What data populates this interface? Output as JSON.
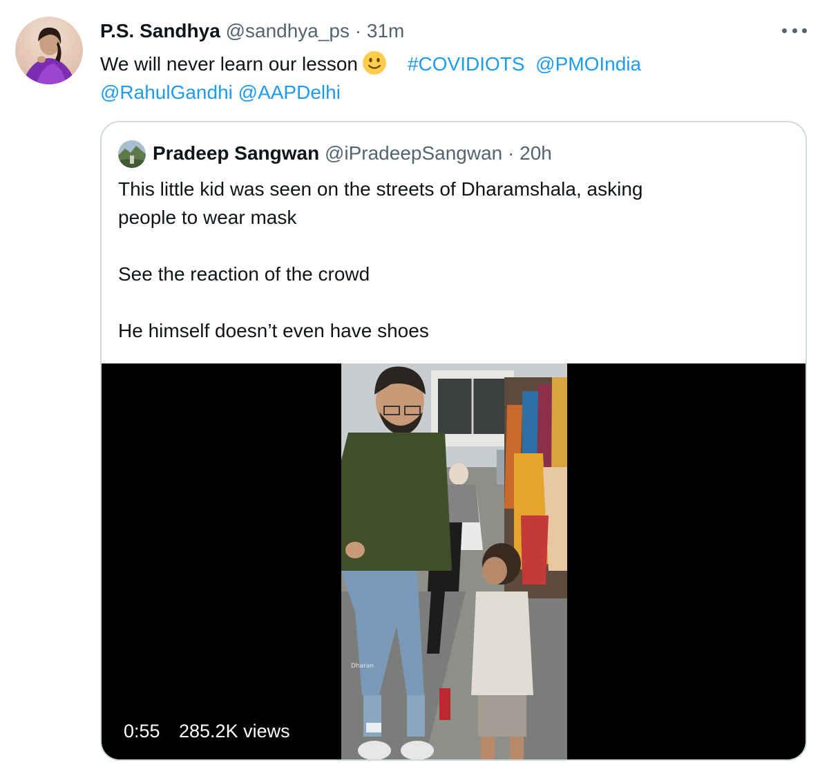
{
  "tweet": {
    "author_name": "P.S. Sandhya",
    "author_handle": "@sandhya_ps",
    "separator": "·",
    "time": "31m",
    "text": "We will never learn our lesson",
    "emoji_icon": "slightly-smiling-face-icon",
    "hashtag": "#COVIDIOTS",
    "mentions": [
      "@PMOIndia",
      "@RahulGandhi",
      "@AAPDelhi"
    ],
    "more_icon": "more-dots-icon"
  },
  "quoted": {
    "author_name": "Pradeep Sangwan",
    "author_handle": "@iPradeepSangwan",
    "separator": "·",
    "time": "20h",
    "lines": [
      "This little kid was seen on the streets of Dharamshala, asking",
      "people to wear mask",
      "",
      "See the reaction of the crowd",
      "",
      "He himself doesn’t even have shoes"
    ],
    "video": {
      "duration": "0:55",
      "views": "285.2K views",
      "watermark_icon": "dharamshala-watermark"
    }
  },
  "colors": {
    "link": "#1d9bf0",
    "text": "#0f1419",
    "secondary": "#536471",
    "border": "#cfd9de"
  }
}
